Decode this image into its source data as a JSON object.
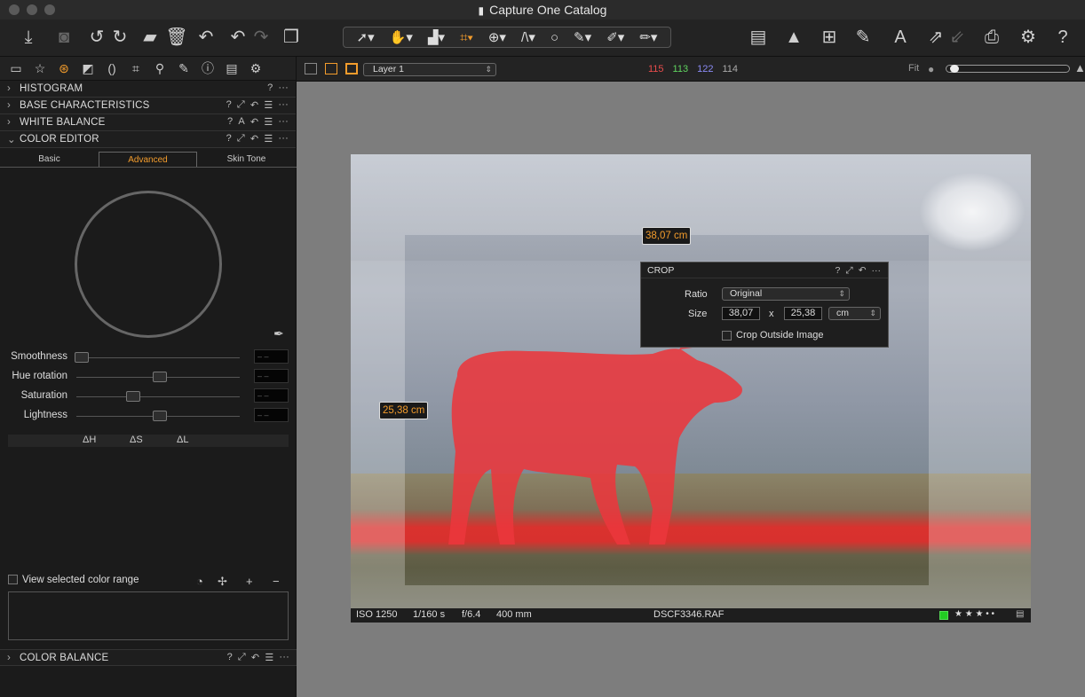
{
  "window": {
    "title": "Capture One Catalog"
  },
  "toolbar": {
    "left_icons": [
      "import-icon",
      "camera-icon",
      "rotate-left-icon",
      "rotate-right-icon",
      "move-to-folder-icon",
      "trash-icon",
      "undo-history-icon",
      "undo-icon",
      "redo-icon",
      "stack-icon"
    ],
    "cursor_tools": [
      "select-cursor-icon",
      "pan-hand-icon",
      "loupe-icon",
      "crop-icon",
      "rotate-icon",
      "straighten-icon",
      "circle-icon",
      "brush-icon",
      "eraser-icon",
      "pen-icon"
    ],
    "right_icons": [
      "viewer-icon",
      "exposure-warning-icon",
      "grid-icon",
      "brush-preset-icon",
      "text-overlay-icon",
      "copy-adjustments-icon",
      "print-icon",
      "settings-icon",
      "help-icon"
    ]
  },
  "tool_tabs": [
    "folder-icon",
    "star-icon",
    "color-icon",
    "exposure-icon",
    "lens-icon",
    "crop-tab-icon",
    "details-icon",
    "local-adjust-icon",
    "info-icon",
    "metadata-icon",
    "gear-icon"
  ],
  "sections": {
    "histogram": "HISTOGRAM",
    "base_characteristics": "BASE CHARACTERISTICS",
    "white_balance": "WHITE BALANCE",
    "color_editor": "COLOR EDITOR",
    "color_balance": "COLOR BALANCE"
  },
  "color_editor": {
    "tabs": [
      "Basic",
      "Advanced",
      "Skin Tone"
    ],
    "active_tab": "Advanced",
    "sliders": [
      {
        "label": "Smoothness",
        "value": "– –",
        "position": 0.03
      },
      {
        "label": "Hue rotation",
        "value": "– –",
        "position": 0.5
      },
      {
        "label": "Saturation",
        "value": "– –",
        "position": 0.35
      },
      {
        "label": "Lightness",
        "value": "– –",
        "position": 0.5
      }
    ],
    "deltas": [
      "ΔH",
      "ΔS",
      "ΔL"
    ],
    "view_selected_label": "View selected color range"
  },
  "viewer": {
    "layer": "Layer 1",
    "rgb": {
      "r": "115",
      "g": "113",
      "b": "122",
      "l": "114"
    },
    "colors": {
      "r": "#e94c4c",
      "g": "#5fd35f",
      "b": "#8b8bf5",
      "l": "#aaaaaa"
    },
    "fit_label": "Fit",
    "width_measure": "38,07 cm",
    "height_measure": "25,38 cm"
  },
  "crop_panel": {
    "title": "CROP",
    "ratio_label": "Ratio",
    "ratio_value": "Original",
    "size_label": "Size",
    "width": "38,07",
    "x": "x",
    "height": "25,38",
    "unit": "cm",
    "outside_label": "Crop Outside Image"
  },
  "status": {
    "iso": "ISO 1250",
    "shutter": "1/160 s",
    "aperture": "f/6.4",
    "focal": "400 mm",
    "filename": "DSCF3346.RAF",
    "rating": "★ ★ ★ • •"
  }
}
